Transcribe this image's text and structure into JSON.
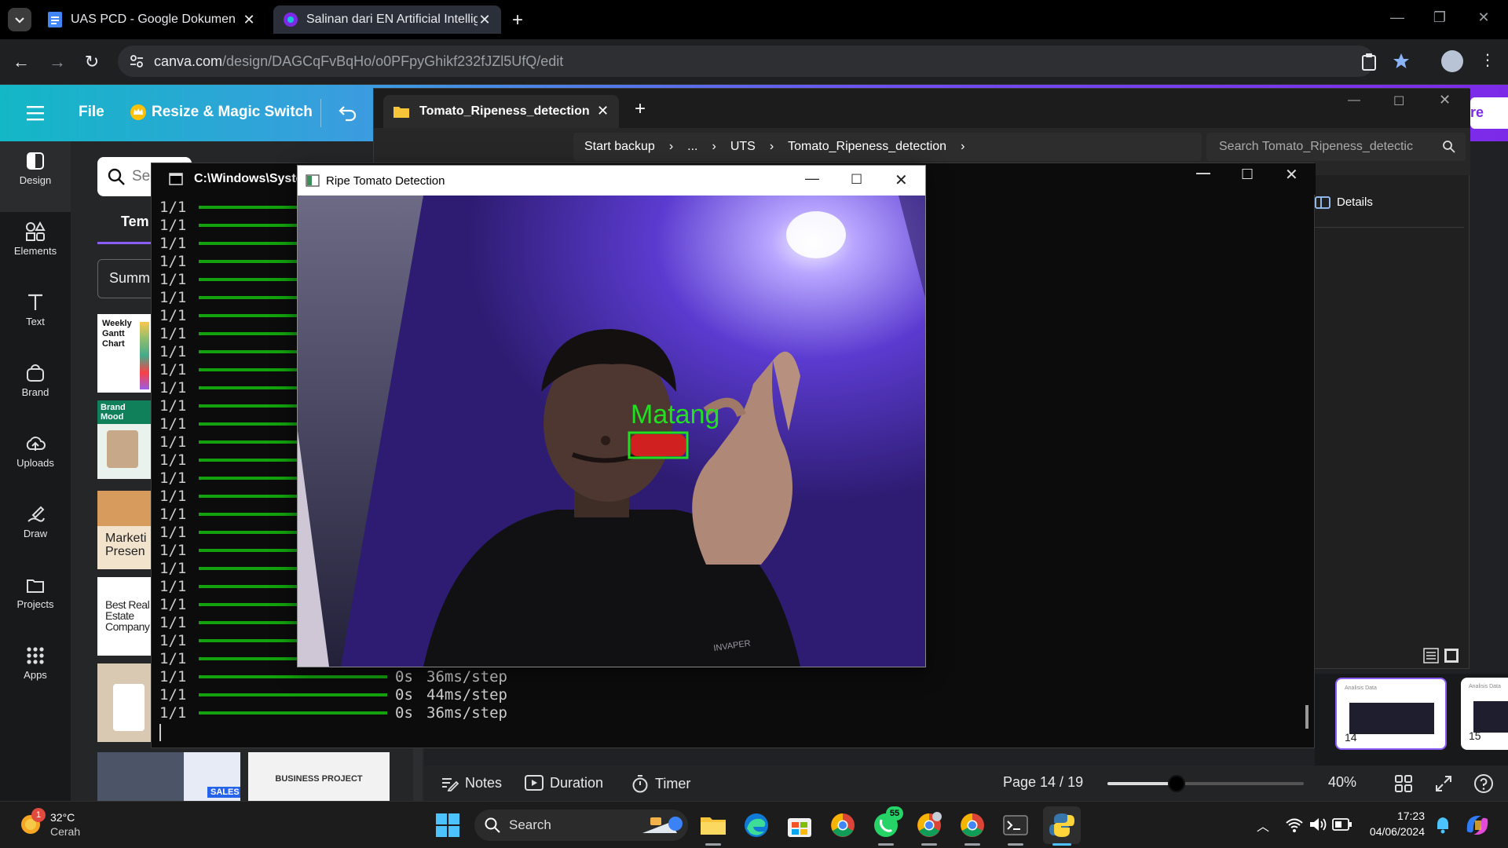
{
  "browser": {
    "tabs": [
      {
        "label": "UAS PCD - Google Dokumen"
      },
      {
        "label": "Salinan dari EN Artificial Intellig"
      }
    ],
    "url_host": "canva.com",
    "url_path": "/design/DAGCqFvBqHo/o0PFpyGhikf232fJZl5UfQ/edit"
  },
  "canva": {
    "file_label": "File",
    "resize_label": "Resize & Magic Switch",
    "share_label_partial": "re",
    "rail": [
      {
        "label": "Design",
        "icon": "design-icon"
      },
      {
        "label": "Elements",
        "icon": "elements-icon"
      },
      {
        "label": "Text",
        "icon": "text-icon"
      },
      {
        "label": "Brand",
        "icon": "brand-icon"
      },
      {
        "label": "Uploads",
        "icon": "uploads-icon"
      },
      {
        "label": "Draw",
        "icon": "draw-icon"
      },
      {
        "label": "Projects",
        "icon": "projects-icon"
      },
      {
        "label": "Apps",
        "icon": "apps-icon"
      }
    ],
    "search_partial": "Se",
    "tab_partial": "Tem",
    "dropdown_partial": "Summ",
    "templates": {
      "gantt_title": "Weekly Gantt Chart",
      "brand_mood": "Brand Mood",
      "marketing": "Marketi Presen",
      "real_estate": "Best Real Estate Company",
      "sales": "SALES",
      "business_project": "BUSINESS PROJECT"
    },
    "bottom": {
      "notes": "Notes",
      "duration": "Duration",
      "timer": "Timer",
      "page": "Page 14 / 19",
      "zoom": "40%",
      "zoom_fraction": 0.35
    },
    "thumbs": [
      {
        "number": "14",
        "title": "Analisis Data"
      },
      {
        "number": "15",
        "title": "Analisis Data"
      }
    ]
  },
  "explorer": {
    "tab_label": "Tomato_Ripeness_detection",
    "breadcrumb": [
      "Start backup",
      "...",
      "UTS",
      "Tomato_Ripeness_detection"
    ],
    "search_placeholder": "Search Tomato_Ripeness_detectic",
    "details_label": "Details"
  },
  "console": {
    "title": "C:\\Windows\\Syster",
    "lines": [
      {
        "step": "1/1",
        "time": "",
        "speed": ""
      },
      {
        "step": "1/1",
        "time": "",
        "speed": ""
      },
      {
        "step": "1/1",
        "time": "",
        "speed": ""
      },
      {
        "step": "1/1",
        "time": "",
        "speed": ""
      },
      {
        "step": "1/1",
        "time": "",
        "speed": ""
      },
      {
        "step": "1/1",
        "time": "",
        "speed": ""
      },
      {
        "step": "1/1",
        "time": "",
        "speed": ""
      },
      {
        "step": "1/1",
        "time": "",
        "speed": ""
      },
      {
        "step": "1/1",
        "time": "",
        "speed": ""
      },
      {
        "step": "1/1",
        "time": "",
        "speed": ""
      },
      {
        "step": "1/1",
        "time": "",
        "speed": ""
      },
      {
        "step": "1/1",
        "time": "",
        "speed": ""
      },
      {
        "step": "1/1",
        "time": "",
        "speed": ""
      },
      {
        "step": "1/1",
        "time": "",
        "speed": ""
      },
      {
        "step": "1/1",
        "time": "",
        "speed": ""
      },
      {
        "step": "1/1",
        "time": "",
        "speed": ""
      },
      {
        "step": "1/1",
        "time": "",
        "speed": ""
      },
      {
        "step": "1/1",
        "time": "",
        "speed": ""
      },
      {
        "step": "1/1",
        "time": "",
        "speed": ""
      },
      {
        "step": "1/1",
        "time": "",
        "speed": ""
      },
      {
        "step": "1/1",
        "time": "",
        "speed": ""
      },
      {
        "step": "1/1",
        "time": "",
        "speed": ""
      },
      {
        "step": "1/1",
        "time": "",
        "speed": ""
      },
      {
        "step": "1/1",
        "time": "",
        "speed": ""
      },
      {
        "step": "1/1",
        "time": "",
        "speed": ""
      },
      {
        "step": "1/1",
        "time": "",
        "speed": ""
      },
      {
        "step": "1/1",
        "time": "0s",
        "speed": "36ms/step"
      },
      {
        "step": "1/1",
        "time": "0s",
        "speed": "44ms/step"
      },
      {
        "step": "1/1",
        "time": "0s",
        "speed": "36ms/step"
      }
    ]
  },
  "cv_window": {
    "title": "Ripe Tomato Detection",
    "detection_label": "Matang",
    "shirt_text": "INVAPER"
  },
  "taskbar": {
    "temperature": "32°C",
    "weather": "Cerah",
    "weather_badge": "1",
    "search_label": "Search",
    "whatsapp_badge": "55",
    "time": "17:23",
    "date": "04/06/2024"
  },
  "colors": {
    "detection": "#20e020",
    "progress": "#13a10e",
    "canva_purple": "#7d2ae8"
  }
}
